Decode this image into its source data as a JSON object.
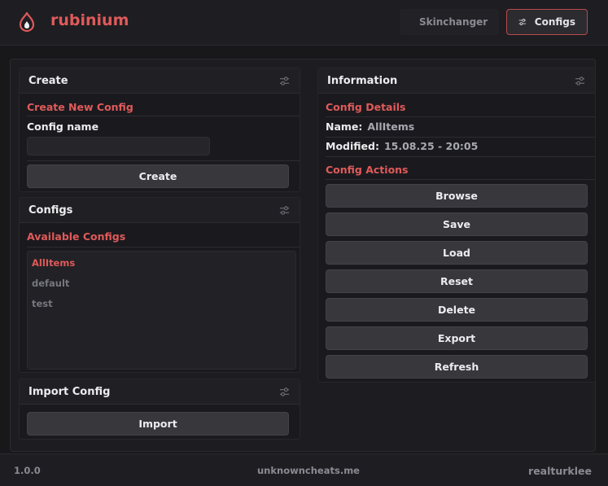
{
  "app": {
    "title": "rubinium",
    "logo": "flame-icon",
    "accent": "#e05a5a"
  },
  "nav": {
    "skinchanger": {
      "label": "Skinchanger",
      "icon": "brush-icon"
    },
    "configs": {
      "label": "Configs",
      "icon": "sliders-icon",
      "active": true
    }
  },
  "create": {
    "title": "Create",
    "section": "Create New Config",
    "name_label": "Config name",
    "name_value": "",
    "button": "Create"
  },
  "configs": {
    "title": "Configs",
    "section": "Available Configs",
    "items": [
      {
        "label": "AllItems",
        "selected": true
      },
      {
        "label": "default",
        "selected": false
      },
      {
        "label": "test",
        "selected": false
      }
    ]
  },
  "import": {
    "title": "Import Config",
    "button": "Import"
  },
  "info": {
    "title": "Information",
    "details_label": "Config Details",
    "name_key": "Name:",
    "name_value": "AllItems",
    "modified_key": "Modified:",
    "modified_value": "15.08.25 - 20:05",
    "actions_label": "Config Actions",
    "actions": [
      "Browse",
      "Save",
      "Load",
      "Reset",
      "Delete",
      "Export",
      "Refresh"
    ]
  },
  "footer": {
    "version": "1.0.0",
    "site": "unknowncheats.me",
    "author": "realturklee"
  }
}
